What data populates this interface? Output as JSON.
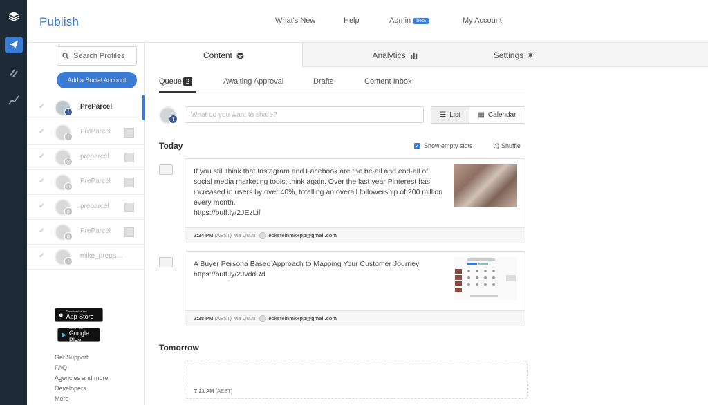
{
  "app": {
    "title": "Publish"
  },
  "rail": {
    "icons": [
      "buffer-logo-icon",
      "publish-paper-plane-icon",
      "reply-icon",
      "analyze-chart-icon"
    ]
  },
  "topnav": {
    "whats_new": "What's New",
    "help": "Help",
    "admin": "Admin",
    "admin_badge": "beta",
    "my_account": "My Account"
  },
  "sidebar": {
    "search_placeholder": "Search Profiles",
    "add_account": "Add a Social Account",
    "profiles": [
      {
        "name": "PreParcel",
        "network": "facebook",
        "selected": true
      },
      {
        "name": "PreParcel",
        "network": "twitter",
        "selected": false
      },
      {
        "name": "preparcel",
        "network": "instagram",
        "selected": false
      },
      {
        "name": "PreParcel",
        "network": "linkedin",
        "selected": false
      },
      {
        "name": "preparcel",
        "network": "pinterest",
        "selected": false
      },
      {
        "name": "PreParcel",
        "network": "google-plus",
        "selected": false
      },
      {
        "name": "mike_prepa…",
        "network": "twitter",
        "selected": false
      }
    ],
    "app_store": {
      "line1": "Download on the",
      "line2": "App Store"
    },
    "google_play": {
      "line1": "GET IT ON",
      "line2": "Google Play"
    },
    "footer_links": [
      "Get Support",
      "FAQ",
      "Agencies and more",
      "Developers",
      "More"
    ]
  },
  "main_tabs": {
    "content": "Content",
    "analytics": "Analytics",
    "settings": "Settings"
  },
  "sub_tabs": {
    "queue": "Queue",
    "queue_count": "2",
    "awaiting": "Awaiting Approval",
    "drafts": "Drafts",
    "inbox": "Content Inbox"
  },
  "composer": {
    "placeholder": "What do you want to share?"
  },
  "view": {
    "list": "List",
    "calendar": "Calendar"
  },
  "today": {
    "heading": "Today",
    "show_empty": "Show empty slots",
    "shuffle": "Shuffle"
  },
  "posts": [
    {
      "text": "If you still think that Instagram and Facebook are the be-all and end-all of social media marketing tools, think again. Over the last year Pinterest has increased in users by over 40%, totalling an overall followership of 200 million every month.",
      "link": "https://buff.ly/2JEzLif",
      "time": "3:34 PM",
      "tz": "(AEST)",
      "via": "via Quuu",
      "email": "ecksteinmk+pp@gmail.com"
    },
    {
      "text": "A Buyer Persona Based Approach to Mapping Your Customer Journey",
      "link": "https://buff.ly/2JvddRd",
      "time": "3:38 PM",
      "tz": "(AEST)",
      "via": "via Quuu",
      "email": "ecksteinmk+pp@gmail.com"
    }
  ],
  "tomorrow": {
    "heading": "Tomorrow",
    "slot_time": "7:21 AM",
    "slot_tz": "(AEST)"
  },
  "colors": {
    "accent": "#3a7bd5",
    "rail": "#1e2a36",
    "facebook": "#3b5998"
  }
}
